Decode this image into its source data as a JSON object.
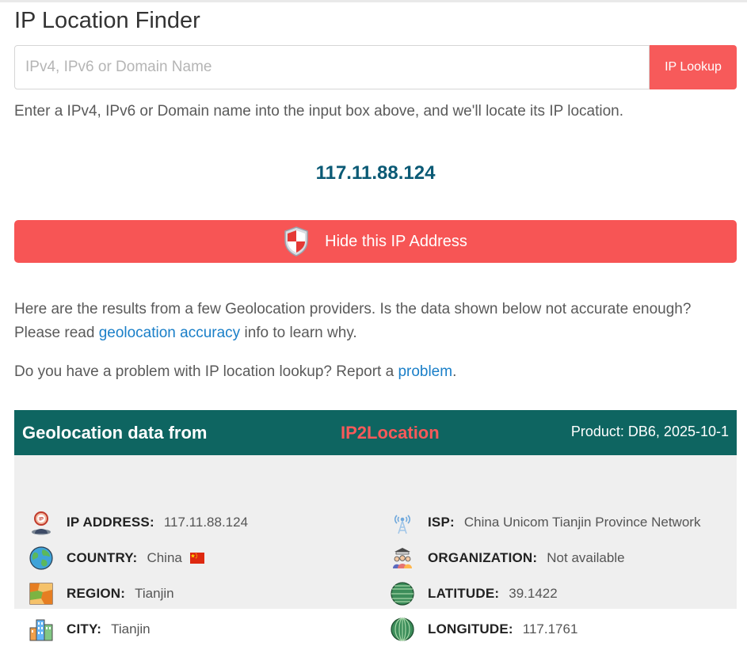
{
  "page": {
    "title": "IP Location Finder",
    "search_placeholder": "IPv4, IPv6 or Domain Name",
    "lookup_button": "IP Lookup",
    "hint": "Enter a IPv4, IPv6 or Domain name into the input box above, and we'll locate its IP location.",
    "current_ip": "117.11.88.124",
    "hide_button": "Hide this IP Address",
    "results_text_a": "Here are the results from a few Geolocation providers. Is the data shown below not accurate enough? Please read ",
    "results_link": "geolocation accuracy",
    "results_text_b": " info to learn why.",
    "problem_text": "Do you have a problem with IP location lookup? Report a ",
    "problem_link": "problem",
    "problem_end": "."
  },
  "provider": {
    "heading": "Geolocation data from",
    "name": "IP2Location",
    "product": "Product: DB6, 2025-10-1",
    "brand_color": "#0e6561",
    "accent_color": "#f75a5a"
  },
  "fields": {
    "ip_address": {
      "label": "IP ADDRESS:",
      "value": "117.11.88.124",
      "icon": "ip-pin-person-icon"
    },
    "country": {
      "label": "COUNTRY:",
      "value": "China",
      "icon": "globe-icon",
      "flag": "china-flag-icon"
    },
    "region": {
      "label": "REGION:",
      "value": "Tianjin",
      "icon": "map-icon"
    },
    "city": {
      "label": "CITY:",
      "value": "Tianjin",
      "icon": "city-buildings-icon"
    },
    "isp": {
      "label": "ISP:",
      "value": "China Unicom Tianjin Province Network",
      "icon": "antenna-tower-icon"
    },
    "organization": {
      "label": "ORGANIZATION:",
      "value": "Not available",
      "icon": "organization-people-icon"
    },
    "latitude": {
      "label": "LATITUDE:",
      "value": "39.1422",
      "icon": "latitude-globe-icon"
    },
    "longitude": {
      "label": "LONGITUDE:",
      "value": "117.1761",
      "icon": "longitude-globe-icon"
    }
  }
}
